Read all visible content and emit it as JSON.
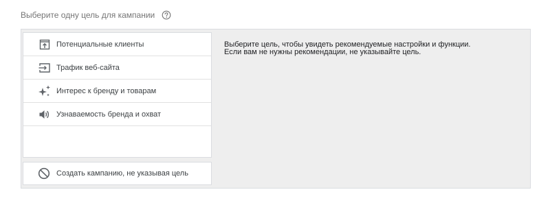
{
  "header": {
    "title": "Выберите одну цель для кампании",
    "help_icon": "help-circle-icon"
  },
  "goals": [
    {
      "label": "Потенциальные клиенты",
      "icon": "leads-icon"
    },
    {
      "label": "Трафик веб-сайта",
      "icon": "website-traffic-icon"
    },
    {
      "label": "Интерес к бренду и товарам",
      "icon": "sparkle-icon"
    },
    {
      "label": "Узнаваемость бренда и охват",
      "icon": "speaker-icon"
    }
  ],
  "no_goal": {
    "label": "Создать кампанию, не указывая цель",
    "icon": "block-icon"
  },
  "description": {
    "line1": "Выберите цель, чтобы увидеть рекомендуемые настройки и функции.",
    "line2": "Если вам не нужны рекомендации, не указывайте цель."
  },
  "colors": {
    "panel_background": "#eeeeee",
    "icon": "#5f6368",
    "border": "#dadce0"
  }
}
